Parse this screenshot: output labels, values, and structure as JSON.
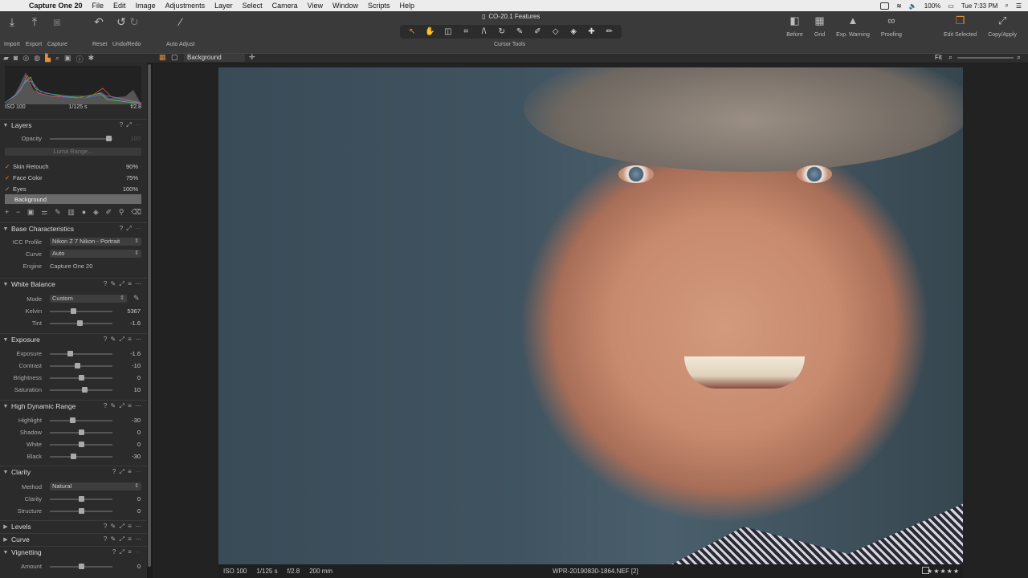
{
  "menubar": {
    "app": "Capture One 20",
    "items": [
      "File",
      "Edit",
      "Image",
      "Adjustments",
      "Layer",
      "Select",
      "Camera",
      "View",
      "Window",
      "Scripts",
      "Help"
    ],
    "battery": "100%",
    "clock": "Tue 7:33 PM"
  },
  "window_title": "CO-20.1 Features",
  "toolbar": {
    "import": "Import",
    "export": "Export",
    "capture": "Capture",
    "reset": "Reset",
    "undo_redo": "Undo/Redo",
    "auto_adjust": "Auto Adjust",
    "cursor_tools": "Cursor Tools",
    "before": "Before",
    "grid": "Grid",
    "exp_warning": "Exp. Warning",
    "proofing": "Proofing",
    "edit_selected": "Edit Selected",
    "copy_apply": "Copy/Apply"
  },
  "viewer_bar": {
    "layer_select": "Background",
    "zoom": "Fit"
  },
  "histogram": {
    "iso": "ISO 100",
    "shutter": "1/125 s",
    "aperture": "f/2.8"
  },
  "layers": {
    "title": "Layers",
    "opacity_label": "Opacity",
    "opacity_value": "100",
    "luma_range": "Luma Range...",
    "items": [
      {
        "name": "Skin Retouch",
        "value": "90%"
      },
      {
        "name": "Face Color",
        "value": "75%"
      },
      {
        "name": "Eyes",
        "value": "100%"
      }
    ],
    "background": "Background"
  },
  "base": {
    "title": "Base Characteristics",
    "icc_label": "ICC Profile",
    "icc_value": "Nikon Z 7 Nikon - Portrait",
    "curve_label": "Curve",
    "curve_value": "Auto",
    "engine_label": "Engine",
    "engine_value": "Capture One 20"
  },
  "wb": {
    "title": "White Balance",
    "mode_label": "Mode",
    "mode_value": "Custom",
    "kelvin_label": "Kelvin",
    "kelvin_value": "5367",
    "tint_label": "Tint",
    "tint_value": "-1.6"
  },
  "exposure": {
    "title": "Exposure",
    "rows": [
      {
        "label": "Exposure",
        "value": "-1.6"
      },
      {
        "label": "Contrast",
        "value": "-10"
      },
      {
        "label": "Brightness",
        "value": "0"
      },
      {
        "label": "Saturation",
        "value": "10"
      }
    ]
  },
  "hdr": {
    "title": "High Dynamic Range",
    "rows": [
      {
        "label": "Highlight",
        "value": "-30"
      },
      {
        "label": "Shadow",
        "value": "0"
      },
      {
        "label": "White",
        "value": "0"
      },
      {
        "label": "Black",
        "value": "-30"
      }
    ]
  },
  "clarity": {
    "title": "Clarity",
    "method_label": "Method",
    "method_value": "Natural",
    "rows": [
      {
        "label": "Clarity",
        "value": "0"
      },
      {
        "label": "Structure",
        "value": "0"
      }
    ]
  },
  "collapsed": {
    "levels": "Levels",
    "curve": "Curve",
    "vignetting": "Vignetting"
  },
  "vignetting": {
    "amount_label": "Amount",
    "amount_value": "0"
  },
  "infobar": {
    "iso": "ISO 100",
    "shutter": "1/125 s",
    "aperture": "f/2.8",
    "focal": "200 mm",
    "filename": "WPR-20190830-1864.NEF [2]",
    "rating": "★★★★★"
  },
  "colors": {
    "accent": "#e39239",
    "panel": "#2b2b2b",
    "toolbar": "#3a3a3a"
  }
}
